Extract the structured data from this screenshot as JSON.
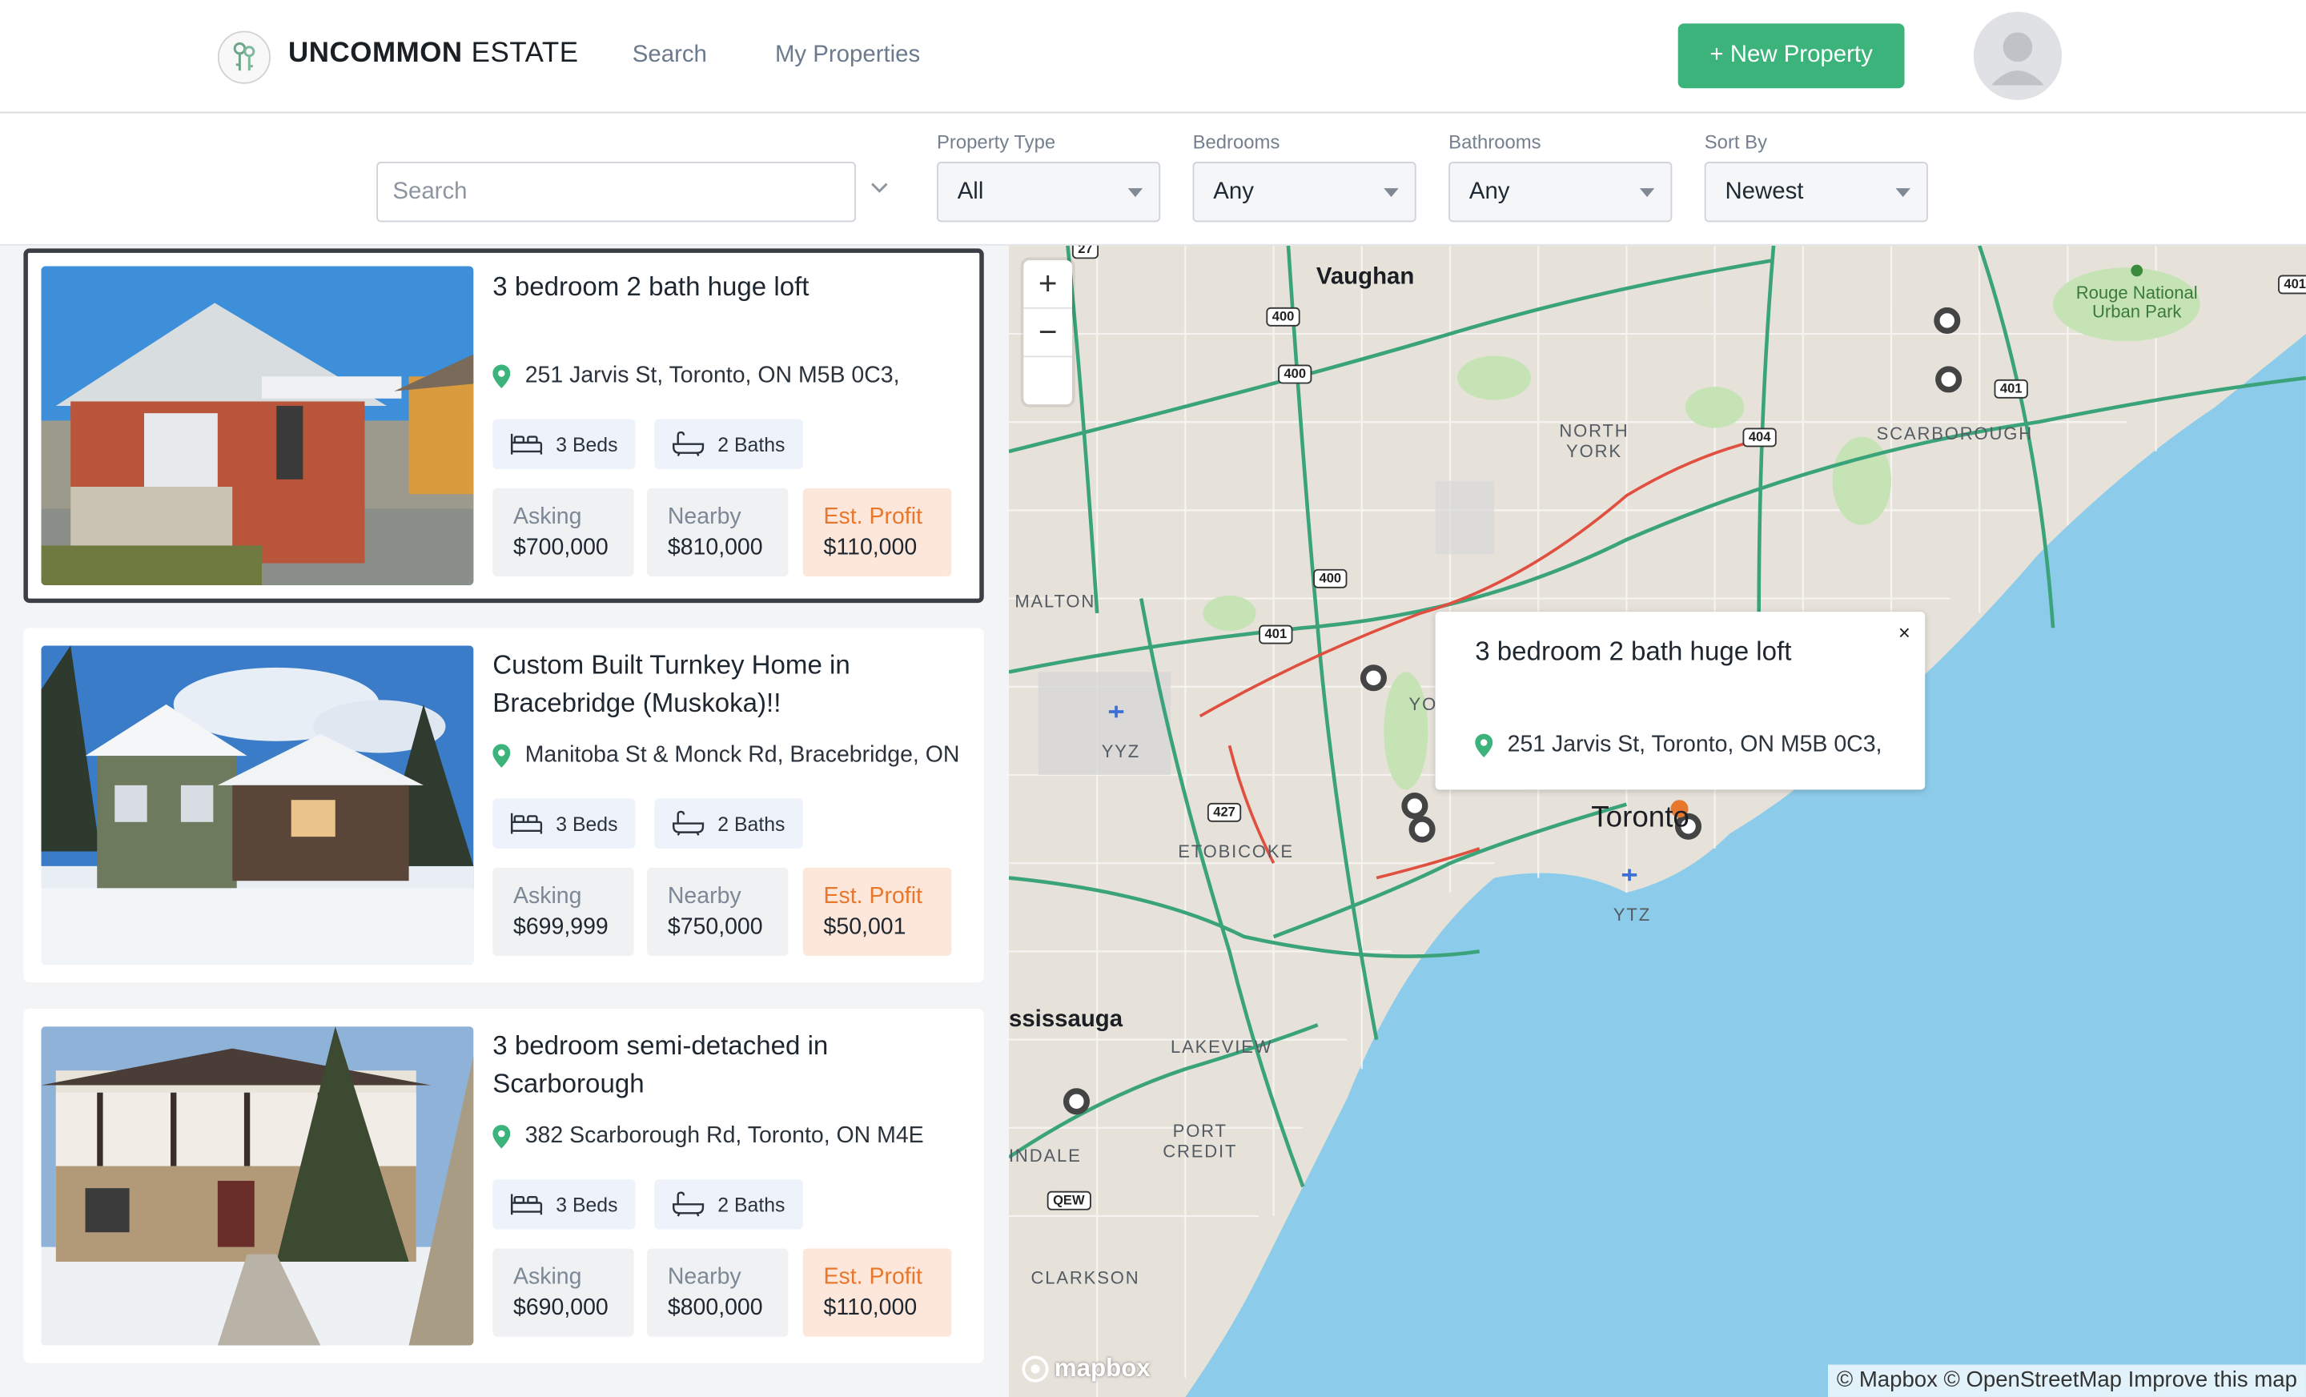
{
  "header": {
    "brand_bold": "UNCOMMON",
    "brand_light": "ESTATE",
    "nav": [
      "Search",
      "My Properties"
    ],
    "new_property_label": "+ New Property"
  },
  "filters": {
    "search_placeholder": "Search",
    "property_type": {
      "label": "Property Type",
      "value": "All"
    },
    "bedrooms": {
      "label": "Bedrooms",
      "value": "Any"
    },
    "bathrooms": {
      "label": "Bathrooms",
      "value": "Any"
    },
    "sort_by": {
      "label": "Sort By",
      "value": "Newest"
    }
  },
  "listings": [
    {
      "title": "3 bedroom 2 bath huge loft",
      "address": "251 Jarvis St, Toronto, ON M5B 0C3,",
      "beds": "3 Beds",
      "baths": "2 Baths",
      "asking_label": "Asking",
      "asking": "$700,000",
      "nearby_label": "Nearby",
      "nearby": "$810,000",
      "profit_label": "Est. Profit",
      "profit": "$110,000",
      "selected": true
    },
    {
      "title": "Custom Built Turnkey Home in Bracebridge (Muskoka)!!",
      "address": "Manitoba St & Monck Rd, Bracebridge, ON",
      "beds": "3 Beds",
      "baths": "2 Baths",
      "asking_label": "Asking",
      "asking": "$699,999",
      "nearby_label": "Nearby",
      "nearby": "$750,000",
      "profit_label": "Est. Profit",
      "profit": "$50,001",
      "selected": false
    },
    {
      "title": "3 bedroom semi-detached in Scarborough",
      "address": "382 Scarborough Rd, Toronto, ON M4E",
      "beds": "3 Beds",
      "baths": "2 Baths",
      "asking_label": "Asking",
      "asking": "$690,000",
      "nearby_label": "Nearby",
      "nearby": "$800,000",
      "profit_label": "Est. Profit",
      "profit": "$110,000",
      "selected": false
    }
  ],
  "map": {
    "popup": {
      "title": "3 bedroom 2 bath huge loft",
      "address": "251 Jarvis St, Toronto, ON M5B 0C3,",
      "close": "×"
    },
    "zoom_in": "+",
    "zoom_out": "−",
    "labels": {
      "vaughan": "Vaughan",
      "north_york": "NORTH YORK",
      "scarborough": "SCARBOROUGH",
      "malton": "MALTON",
      "etobicoke": "ETOBICOKE",
      "toronto": "Toronto",
      "mississauga": "ssissauga",
      "lakeview": "LAKEVIEW",
      "port_credit": "PORT CREDIT",
      "indale": "INDALE",
      "clarkson": "CLARKSON",
      "yyz": "YYZ",
      "ytz": "YTZ",
      "yo": "YO",
      "rouge": "Rouge National Urban Park"
    },
    "highways": [
      "27",
      "400",
      "400",
      "400",
      "401",
      "401",
      "404",
      "427",
      "QEW",
      "401"
    ],
    "attribution": "© Mapbox © OpenStreetMap Improve this map",
    "logo": "mapbox"
  }
}
